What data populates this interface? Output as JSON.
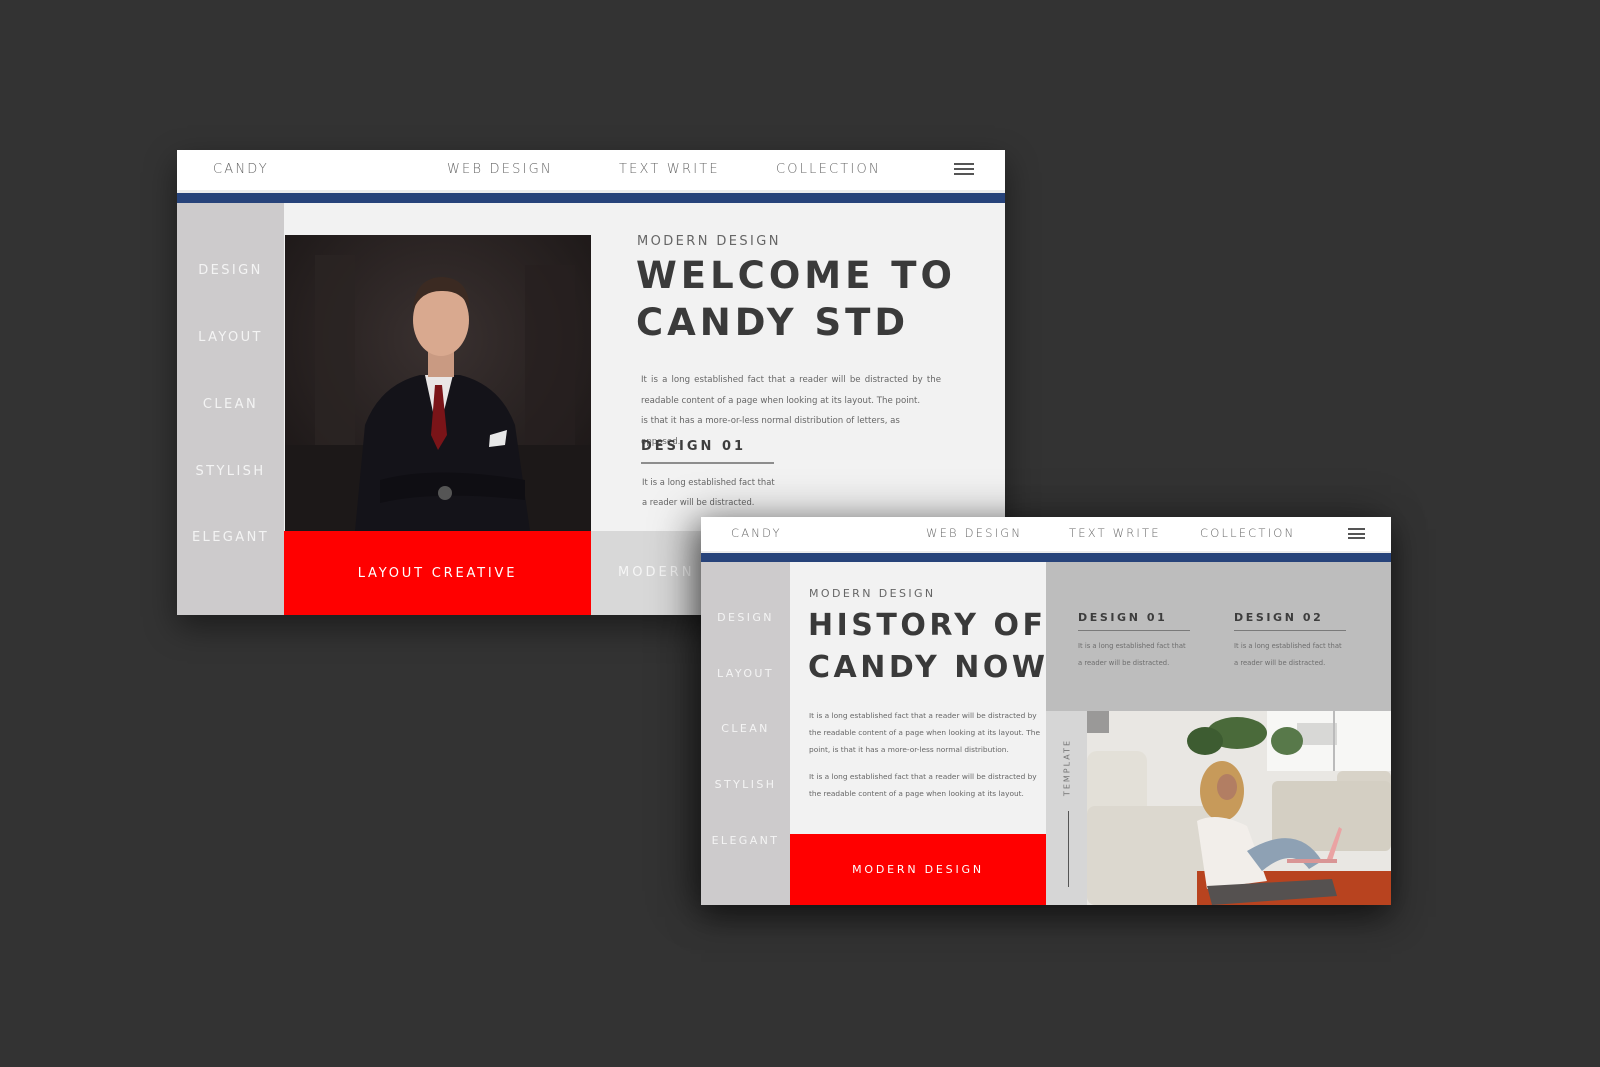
{
  "colors": {
    "background": "#333333",
    "accent_navy": "#27437a",
    "accent_red": "#ff0000",
    "sidebar_grey": "#cdcbcc",
    "panel_grey": "#bdbdbd",
    "content_bg": "#f2f2f2",
    "heading_text": "#3a3a3a"
  },
  "mockups": [
    {
      "nav": {
        "brand": "CANDY",
        "links": [
          "WEB DESIGN",
          "TEXT WRITE",
          "COLLECTION"
        ],
        "menu_icon": "hamburger-icon"
      },
      "sidebar": {
        "items": [
          "DESIGN",
          "LAYOUT",
          "CLEAN",
          "STYLISH",
          "ELEGANT"
        ]
      },
      "hero": {
        "photo": "man-in-suit-photo",
        "eyebrow": "MODERN DESIGN",
        "headline_line1": "WELCOME TO",
        "headline_line2": "CANDY STD",
        "paragraph_lines": [
          "It is a long established fact that a reader will be distracted by the",
          "readable content of a page when looking at its layout. The point.",
          " is that it has a more-or-less normal distribution of letters, as opposed."
        ],
        "design_block": {
          "title": "DESIGN   01",
          "lines": [
            "It is a long established fact that",
            "a reader will be distracted."
          ]
        },
        "red_button": "LAYOUT CREATIVE",
        "grey_label": "MODERN DESIGN"
      }
    },
    {
      "nav": {
        "brand": "CANDY",
        "links": [
          "WEB DESIGN",
          "TEXT WRITE",
          "COLLECTION"
        ],
        "menu_icon": "hamburger-icon"
      },
      "sidebar": {
        "items": [
          "DESIGN",
          "LAYOUT",
          "CLEAN",
          "STYLISH",
          "ELEGANT"
        ]
      },
      "content": {
        "eyebrow": "MODERN DESIGN",
        "headline_line1": "HISTORY OF",
        "headline_line2": "CANDY NOW",
        "paragraph1_lines": [
          "It is a long established fact that a reader will be distracted by",
          "the readable content of a page when looking at its layout. The",
          "point, is that it has a more-or-less normal distribution."
        ],
        "paragraph2_lines": [
          "It is a long established fact that a reader will be distracted by",
          "the readable content of a page when looking at its layout."
        ],
        "red_button": "MODERN DESIGN",
        "design_blocks": [
          {
            "title": "DESIGN   01",
            "lines": [
              "It is a long established fact that",
              "a reader will be distracted."
            ]
          },
          {
            "title": "DESIGN   02",
            "lines": [
              "It is a long established fact that",
              "a reader will be distracted."
            ]
          }
        ],
        "vertical_label": "TEMPLATE",
        "photo": "woman-with-laptop-photo"
      }
    }
  ]
}
